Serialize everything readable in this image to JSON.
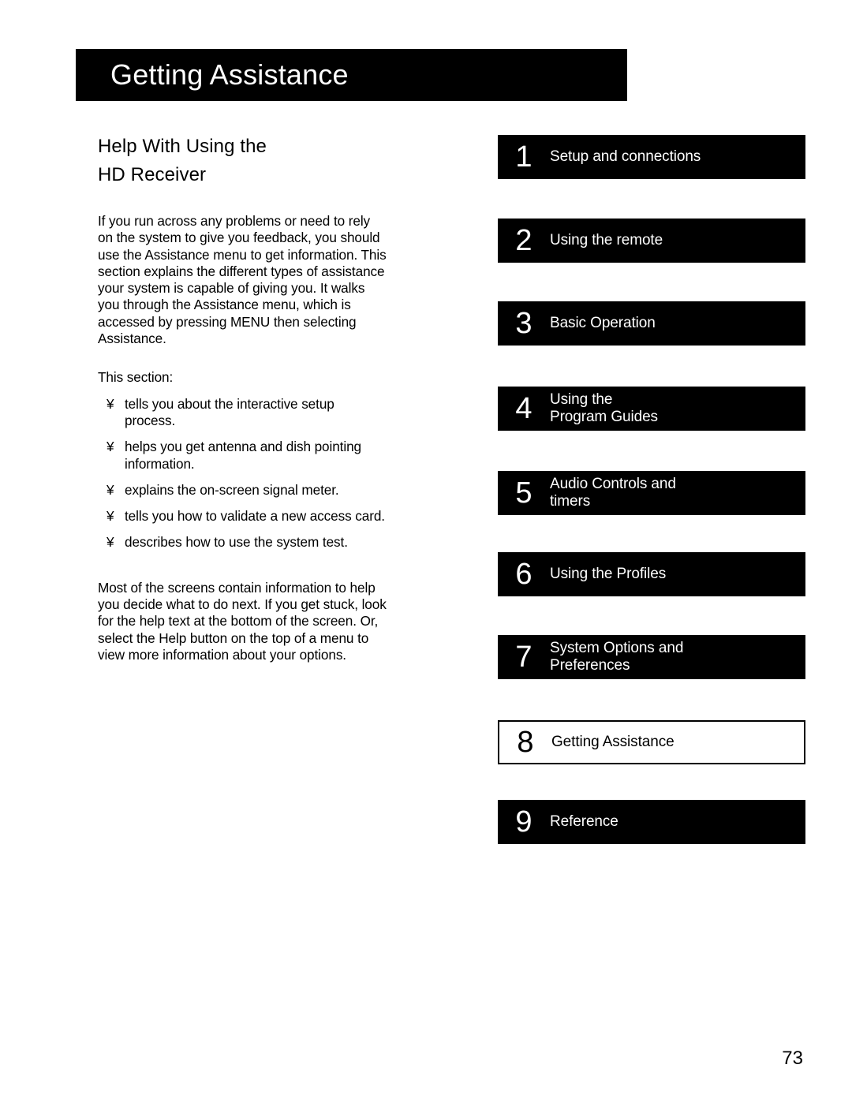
{
  "page": {
    "title": "Getting Assistance",
    "number": "73"
  },
  "left_column": {
    "heading_line1": "Help With Using the",
    "heading_line2": "HD Receiver",
    "intro_paragraph": "If you run across any problems or need to rely on the system to give you feedback, you should use the Assistance menu to get information. This section explains the different types of assistance your system is capable of giving you. It walks you through the Assistance menu, which is accessed by pressing MENU then selecting  Assistance.",
    "list_intro": "This section:",
    "bullet_glyph": "¥",
    "bullets": [
      "tells you about the interactive setup process.",
      "helps you get antenna and dish pointing information.",
      "explains the on-screen signal meter.",
      "tells you how to validate a new access card.",
      "describes how to use the system test."
    ],
    "closing_paragraph": "Most of the screens contain information to help you decide what to do next. If you get stuck, look for the help text at the bottom of the screen. Or, select the Help button on the top of a menu to view more information about your options."
  },
  "tabs": [
    {
      "number": "1",
      "label": "Setup and connections",
      "active": false
    },
    {
      "number": "2",
      "label": "Using the remote",
      "active": false
    },
    {
      "number": "3",
      "label": "Basic Operation",
      "active": false
    },
    {
      "number": "4",
      "label": "Using the\nProgram Guides",
      "active": false
    },
    {
      "number": "5",
      "label": "Audio Controls and\ntimers",
      "active": false
    },
    {
      "number": "6",
      "label": "Using the Profiles",
      "active": false
    },
    {
      "number": "7",
      "label": "System Options and\nPreferences",
      "active": false
    },
    {
      "number": "8",
      "label": "Getting Assistance",
      "active": true
    },
    {
      "number": "9",
      "label": "Reference",
      "active": false
    }
  ],
  "colors": {
    "banner_background": "#000000",
    "banner_text": "#ffffff",
    "tab_background": "#000000",
    "tab_text": "#ffffff",
    "active_tab_background": "#ffffff",
    "active_tab_text": "#000000",
    "page_background": "#ffffff"
  }
}
